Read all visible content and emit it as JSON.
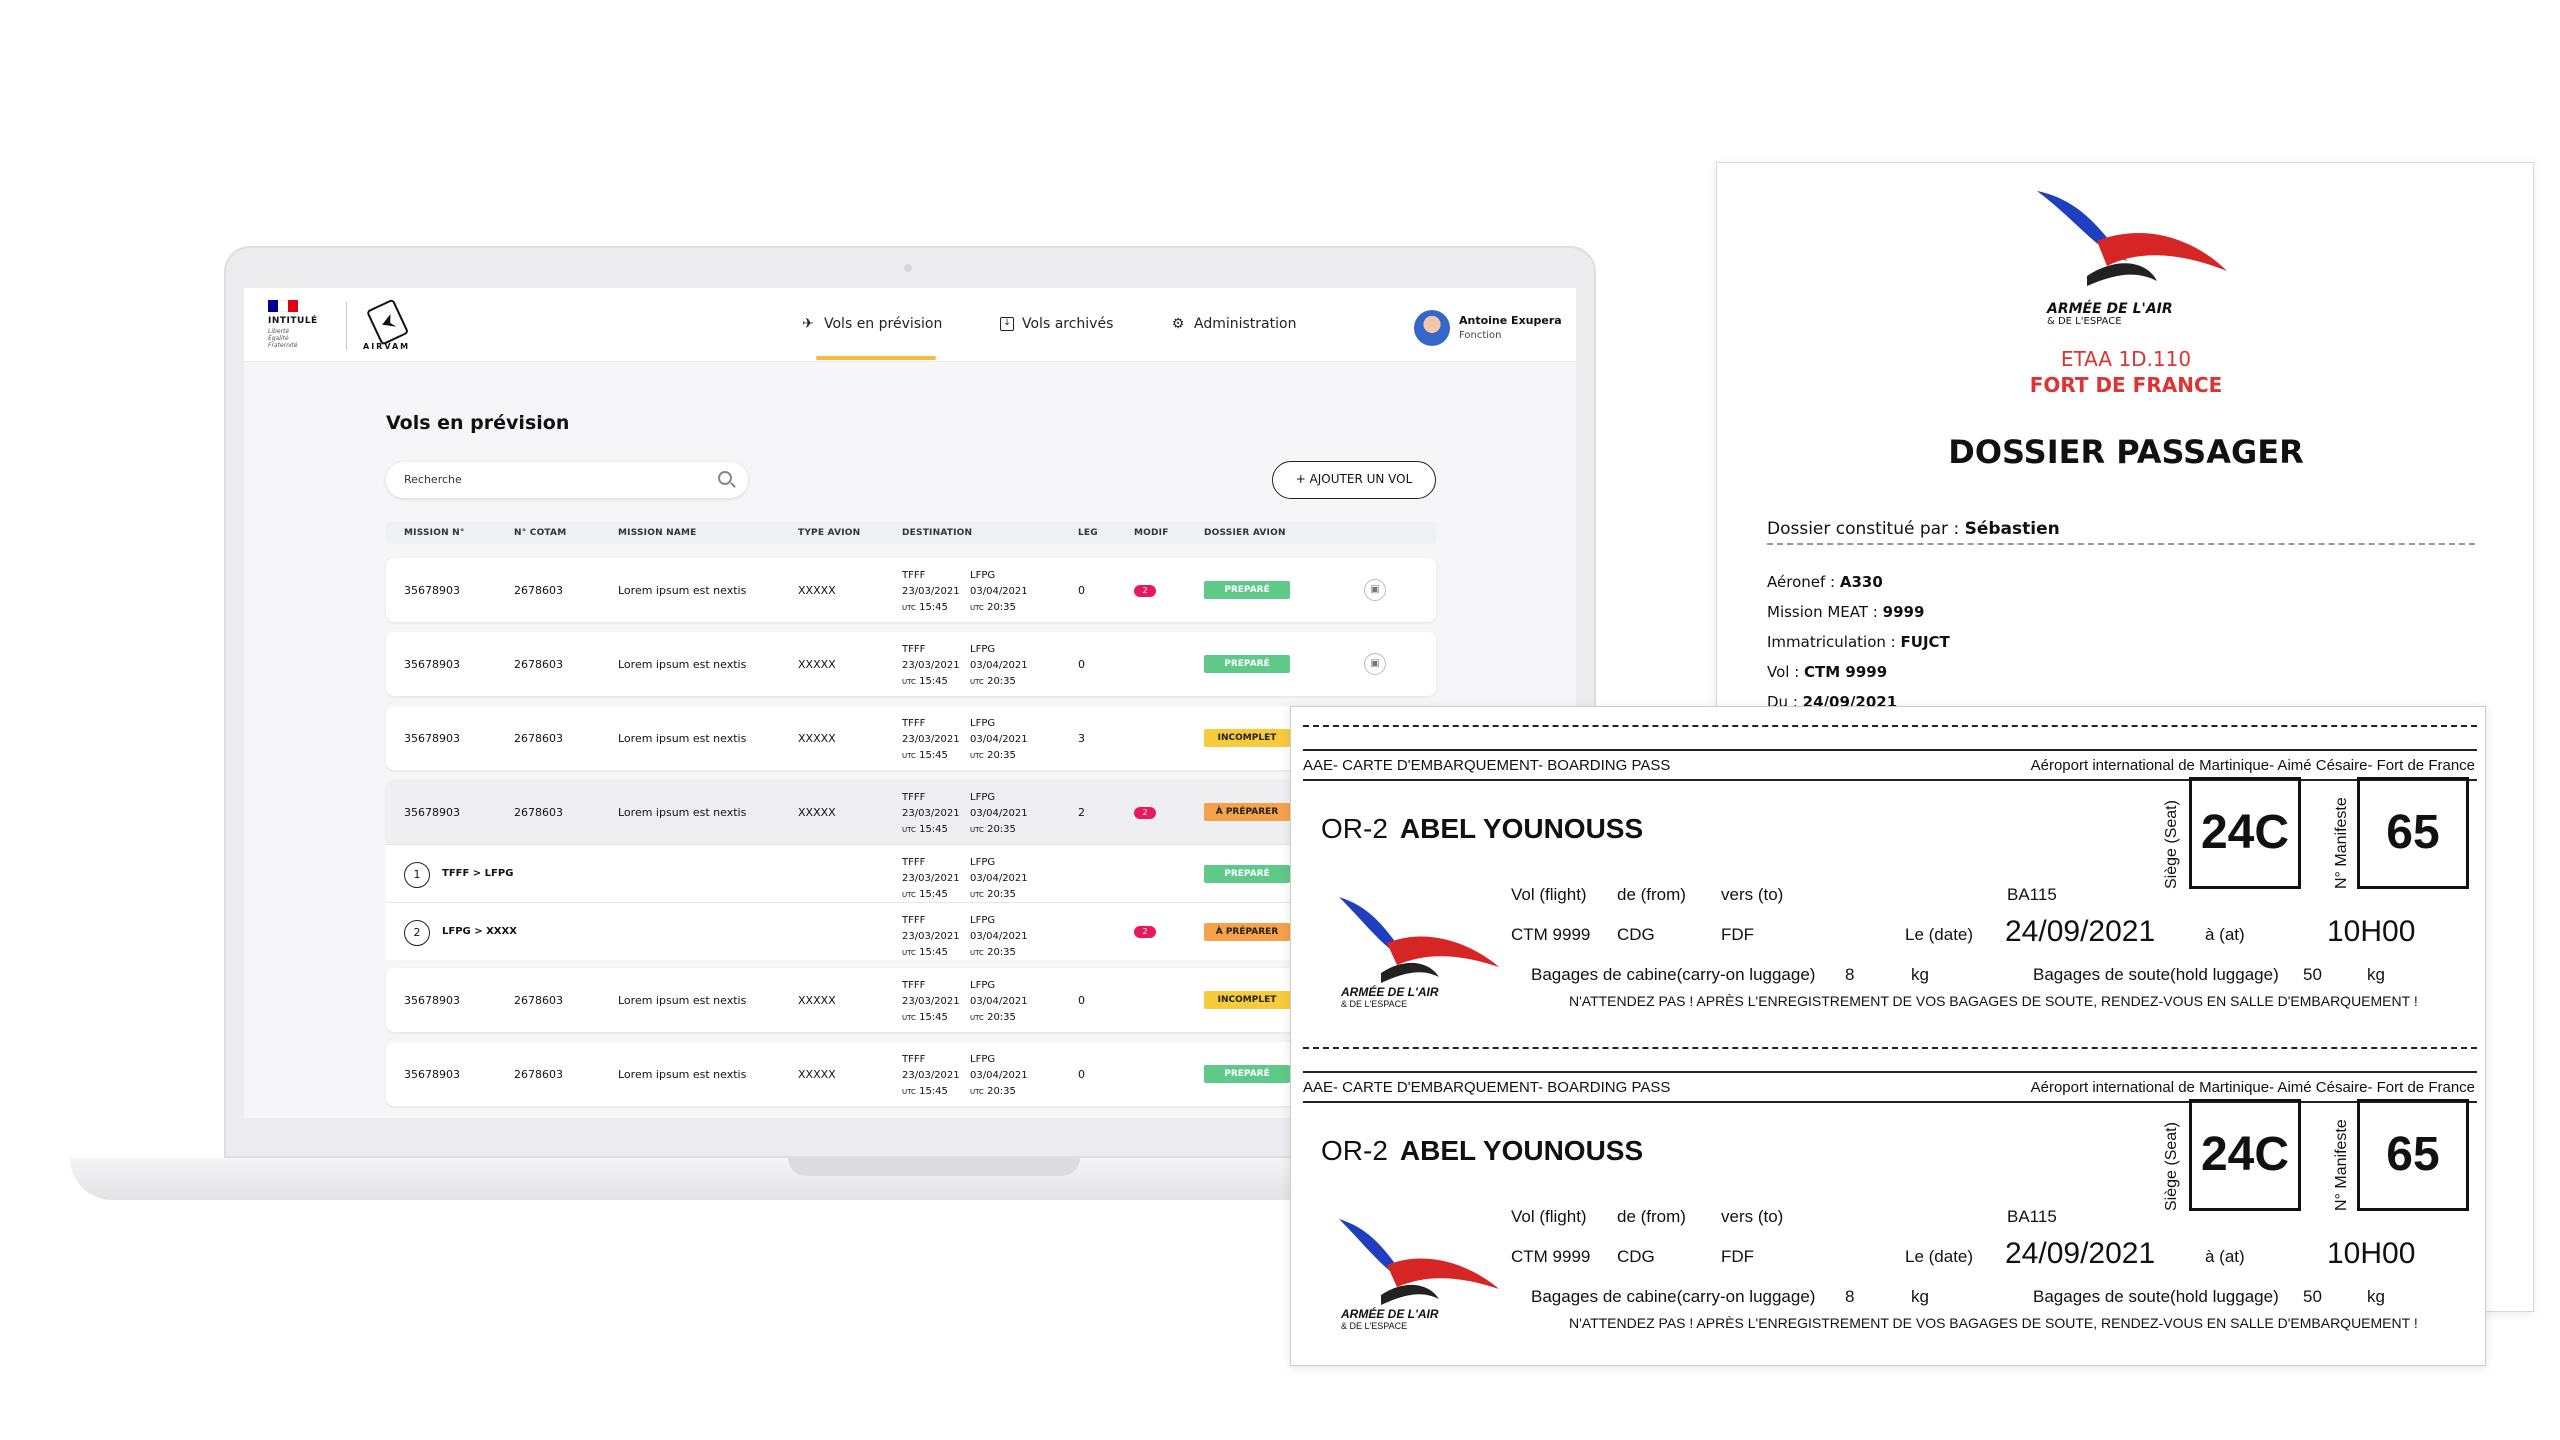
{
  "app": {
    "gov_name": "INTITULÉ",
    "gov_motto": [
      "Liberté",
      "Égalité",
      "Fraternité"
    ],
    "brand": "AIRVAM",
    "nav": {
      "vols_prevision": "Vols en prévision",
      "vols_archives": "Vols archivés",
      "administration": "Administration"
    },
    "user": {
      "name": "Antoine Exupera",
      "role": "Fonction"
    },
    "page_title": "Vols en prévision",
    "search_placeholder": "Recherche",
    "add_button": "+ AJOUTER UN VOL",
    "columns": [
      "MISSION N°",
      "N° COTAM",
      "MISSION NAME",
      "TYPE AVION",
      "DESTINATION",
      "LEG",
      "MODIF",
      "DOSSIER AVION"
    ],
    "rows": [
      {
        "mission": "35678903",
        "cotam": "2678603",
        "name": "Lorem ipsum est nextis",
        "avion": "XXXXX",
        "from": "TFFF",
        "to": "LFPG",
        "date_from": "23/03/2021",
        "date_to": "03/04/2021",
        "utc_from": "15:45",
        "utc_to": "20:35",
        "leg": "0",
        "modif": "2",
        "status": "PREPARÉ"
      },
      {
        "mission": "35678903",
        "cotam": "2678603",
        "name": "Lorem ipsum est nextis",
        "avion": "XXXXX",
        "from": "TFFF",
        "to": "LFPG",
        "date_from": "23/03/2021",
        "date_to": "03/04/2021",
        "utc_from": "15:45",
        "utc_to": "20:35",
        "leg": "0",
        "modif": "",
        "status": "PREPARÉ"
      },
      {
        "mission": "35678903",
        "cotam": "2678603",
        "name": "Lorem ipsum est nextis",
        "avion": "XXXXX",
        "from": "TFFF",
        "to": "LFPG",
        "date_from": "23/03/2021",
        "date_to": "03/04/2021",
        "utc_from": "15:45",
        "utc_to": "20:35",
        "leg": "3",
        "modif": "",
        "status": "INCOMPLET"
      },
      {
        "mission": "35678903",
        "cotam": "2678603",
        "name": "Lorem ipsum est nextis",
        "avion": "XXXXX",
        "from": "TFFF",
        "to": "LFPG",
        "date_from": "23/03/2021",
        "date_to": "03/04/2021",
        "utc_from": "15:45",
        "utc_to": "20:35",
        "leg": "2",
        "modif": "2",
        "status": "À PRÉPARER"
      }
    ],
    "sub_rows": [
      {
        "num": "1",
        "route": "TFFF > LFPG",
        "from": "TFFF",
        "to": "LFPG",
        "date_from": "23/03/2021",
        "date_to": "03/04/2021",
        "utc_from": "15:45",
        "utc_to": "20:35",
        "modif": "",
        "status": "PREPARÉ"
      },
      {
        "num": "2",
        "route": "LFPG > XXXX",
        "from": "TFFF",
        "to": "LFPG",
        "date_from": "23/03/2021",
        "date_to": "03/04/2021",
        "utc_from": "15:45",
        "utc_to": "20:35",
        "modif": "2",
        "status": "À PRÉPARER"
      }
    ],
    "rows_after": [
      {
        "mission": "35678903",
        "cotam": "2678603",
        "name": "Lorem ipsum est nextis",
        "avion": "XXXXX",
        "from": "TFFF",
        "to": "LFPG",
        "date_from": "23/03/2021",
        "date_to": "03/04/2021",
        "utc_from": "15:45",
        "utc_to": "20:35",
        "leg": "0",
        "modif": "",
        "status": "INCOMPLET"
      },
      {
        "mission": "35678903",
        "cotam": "2678603",
        "name": "Lorem ipsum est nextis",
        "avion": "XXXXX",
        "from": "TFFF",
        "to": "LFPG",
        "date_from": "23/03/2021",
        "date_to": "03/04/2021",
        "utc_from": "15:45",
        "utc_to": "20:35",
        "leg": "0",
        "modif": "",
        "status": "PREPARÉ"
      }
    ],
    "utc_label": "UTC"
  },
  "dossier": {
    "logo_line1": "ARMÉE DE L'AIR",
    "logo_line2": "& DE L'ESPACE",
    "unit": "ETAA 1D.110",
    "base": "FORT DE FRANCE",
    "title": "DOSSIER PASSAGER",
    "constitue_label": "Dossier constitué par :",
    "constitue_value": "Sébastien",
    "fields": [
      {
        "label": "Aéronef :",
        "value": "A330"
      },
      {
        "label": "Mission MEAT :",
        "value": "9999"
      },
      {
        "label": "Immatriculation :",
        "value": "FUJCT"
      },
      {
        "label": "Vol :",
        "value": "CTM 9999"
      },
      {
        "label": "Du :",
        "value": "24/09/2021"
      }
    ]
  },
  "pass": {
    "header_left": "AAE- CARTE D'EMBARQUEMENT- BOARDING PASS",
    "header_right": "Aéroport international de Martinique- Aimé Césaire- Fort de France",
    "prefix": "OR-2",
    "passenger": "ABEL YOUNOUSS",
    "seat_label": "Siège (Seat)",
    "seat": "24C",
    "manifest_label": "N° Manifeste",
    "manifest": "65",
    "vol_label": "Vol (flight)",
    "from_label": "de (from)",
    "to_label": "vers (to)",
    "ba": "BA115",
    "flight": "CTM 9999",
    "from": "CDG",
    "to": "FDF",
    "date_label": "Le (date)",
    "date": "24/09/2021",
    "at_label": "à (at)",
    "time": "10H00",
    "cabin_label": "Bagages de cabine(carry-on luggage)",
    "cabin_value": "8",
    "cabin_unit": "kg",
    "hold_label": "Bagages de soute(hold luggage)",
    "hold_value": "50",
    "hold_unit": "kg",
    "warning": "N'ATTENDEZ PAS ! APRÈS L'ENREGISTREMENT DE VOS BAGAGES DE SOUTE, RENDEZ-VOUS EN SALLE D'EMBARQUEMENT !",
    "logo_line1": "ARMÉE DE L'AIR",
    "logo_line2": "& DE L'ESPACE"
  },
  "colors": {
    "accent": "#f5b93e",
    "prepare": "#5fc98a",
    "incomplet": "#f7cb3c",
    "a_preparer": "#f6a24a",
    "modif": "#e8185c",
    "aae_red": "#d33"
  }
}
